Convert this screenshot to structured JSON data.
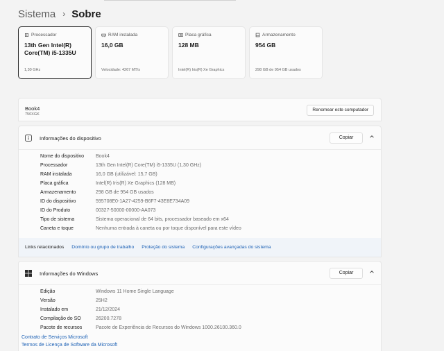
{
  "breadcrumb": {
    "parent": "Sistema",
    "separator": "›",
    "current": "Sobre"
  },
  "specs": [
    {
      "icon": "processor-icon",
      "caption": "Processador",
      "value": "13th Gen Intel(R) Core(TM) i5-1335U",
      "sub": "1,30 GHz"
    },
    {
      "icon": "ram-icon",
      "caption": "RAM instalada",
      "value": "16,0 GB",
      "sub": "Velocidade: 4267 MT/s"
    },
    {
      "icon": "graphics-card-icon",
      "caption": "Placa gráfica",
      "value": "128 MB",
      "sub": "Intel(R) Iris(R) Xe Graphics"
    },
    {
      "icon": "storage-icon",
      "caption": "Armazenamento",
      "value": "954 GB",
      "sub": "298 GB de 954 GB usados"
    }
  ],
  "device": {
    "name": "Book4",
    "model": "750XGK",
    "rename_label": "Renomear este computador"
  },
  "device_info": {
    "title": "Informações do dispositivo",
    "copy_label": "Copiar",
    "rows": [
      {
        "k": "Nome do dispositivo",
        "v": "Book4"
      },
      {
        "k": "Processador",
        "v": "13th Gen Intel(R) Core(TM) i5-1335U (1,30 GHz)"
      },
      {
        "k": "RAM instalada",
        "v": "16,0 GB (utilizável: 15,7 GB)"
      },
      {
        "k": "Placa gráfica",
        "v": "Intel(R) Iris(R) Xe Graphics (128 MB)"
      },
      {
        "k": "Armazenamento",
        "v": "298 GB de 954 GB usados"
      },
      {
        "k": "ID do dispositivo",
        "v": "595708E0-1A27-4259-B6F7-43E8E734A09"
      },
      {
        "k": "ID do Produto",
        "v": "00327-50000-00000-AA073"
      },
      {
        "k": "Tipo de sistema",
        "v": "Sistema operacional de 64 bits, processador baseado em x64"
      },
      {
        "k": "Caneta e toque",
        "v": "Nenhuma entrada à caneta ou por toque disponível para este vídeo"
      }
    ]
  },
  "related": {
    "label": "Links relacionados",
    "links": [
      "Domínio ou grupo de trabalho",
      "Proteção do sistema",
      "Configurações avançadas do sistema"
    ]
  },
  "windows_info": {
    "title": "Informações do Windows",
    "copy_label": "Copiar",
    "rows": [
      {
        "k": "Edição",
        "v": "Windows 11 Home Single Language"
      },
      {
        "k": "Versão",
        "v": "25H2"
      },
      {
        "k": "Instalado em",
        "v": "21/12/2024"
      },
      {
        "k": "Compilação do SO",
        "v": "26200.7278"
      },
      {
        "k": "Pacote de recursos",
        "v": "Pacote de Experiência de Recursos do Windows 1000.26100.360.0"
      }
    ],
    "links": [
      "Contrato de Serviços Microsoft",
      "Termos de Licença de Software da Microsoft"
    ]
  },
  "colors": {
    "accent": "#1a5fb4",
    "windows_logo": "#2b2b2b",
    "related_bg": "#f0f4f9"
  }
}
